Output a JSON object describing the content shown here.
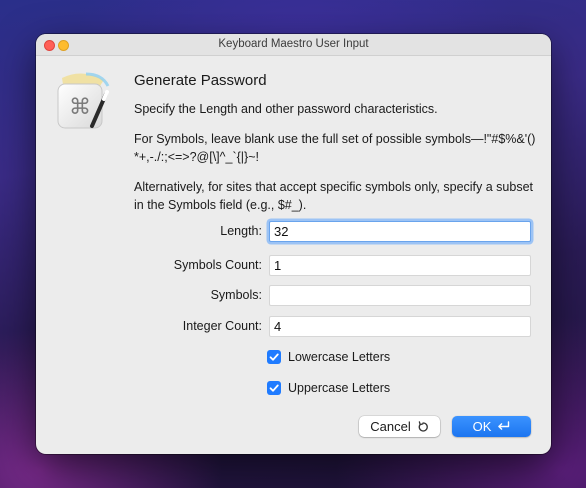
{
  "window": {
    "title": "Keyboard Maestro User Input"
  },
  "dialog": {
    "heading": "Generate Password",
    "paragraphs": [
      "Specify the Length and other password characteristics.",
      "For Symbols, leave blank use the full set of possible symbols—!\"#$%&'()*+,-./:;<=>?@[\\]^_`{|}~!",
      "Alternatively, for sites that accept specific symbols only, specify a subset in the Symbols field (e.g., $#_)."
    ],
    "fields": [
      {
        "label": "Length:",
        "value": "32"
      },
      {
        "label": "Symbols Count:",
        "value": "1"
      },
      {
        "label": "Symbols:",
        "value": ""
      },
      {
        "label": "Integer Count:",
        "value": "4"
      }
    ],
    "checkboxes": [
      {
        "label": "Lowercase Letters",
        "checked": true
      },
      {
        "label": "Uppercase Letters",
        "checked": true
      }
    ],
    "buttons": {
      "cancel_label": "Cancel",
      "ok_label": "OK"
    }
  },
  "icons": {
    "app": "keyboard-maestro-app-icon",
    "cancel": "undo-arrow-icon",
    "ok": "return-arrow-icon",
    "checkmark": "checkmark-icon"
  },
  "colors": {
    "accent": "#1f7bff",
    "focus_ring": "#9cc3f5",
    "close": "#ff5f57",
    "minimize": "#febc2e"
  }
}
